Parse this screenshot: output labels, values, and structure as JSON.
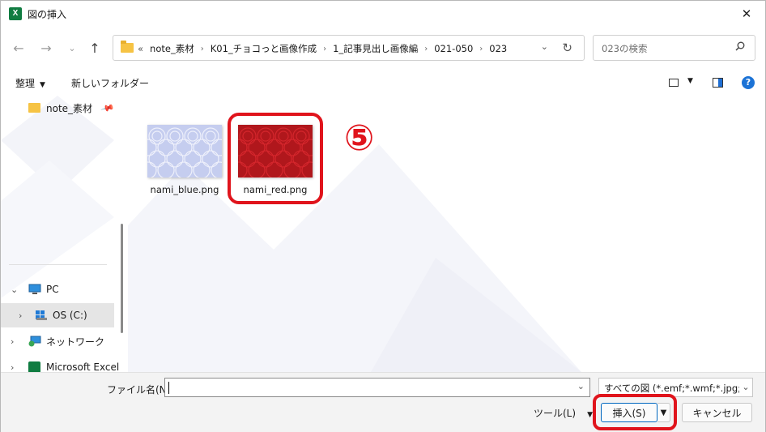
{
  "window": {
    "title": "図の挿入",
    "app_icon_label": "X"
  },
  "nav": {
    "crumbs_prefix": "«",
    "crumbs": [
      "note_素材",
      "K01_チョコっと画像作成",
      "1_記事見出し画像編",
      "021-050",
      "023"
    ],
    "search_placeholder": "023の検索"
  },
  "toolbar": {
    "organize_label": "整理",
    "new_folder_label": "新しいフォルダー",
    "help_label": "?"
  },
  "sidebar": {
    "items": [
      {
        "label": "note_素材",
        "pinned": true
      },
      {
        "label": "PC"
      },
      {
        "label": "OS (C:)",
        "selected": true
      },
      {
        "label": "ネットワーク"
      },
      {
        "label": "Microsoft Excel"
      }
    ]
  },
  "files": [
    {
      "name": "nami_blue.png",
      "thumb_color": "#c5cdef",
      "pattern_color": "#eef0fb"
    },
    {
      "name": "nami_red.png",
      "thumb_color": "#b0171c",
      "pattern_color": "#d4262c"
    }
  ],
  "annotation": {
    "step_label": "⑤",
    "color": "#e0141c"
  },
  "bottom": {
    "filename_label": "ファイル名(N):",
    "filename_value": "",
    "filetype_value": "すべての図 (*.emf;*.wmf;*.jpg;*.jpeg;*.jfif;*.jpe;*.png)",
    "tools_label": "ツール(L)",
    "insert_label": "挿入(S)",
    "cancel_label": "キャンセル"
  }
}
